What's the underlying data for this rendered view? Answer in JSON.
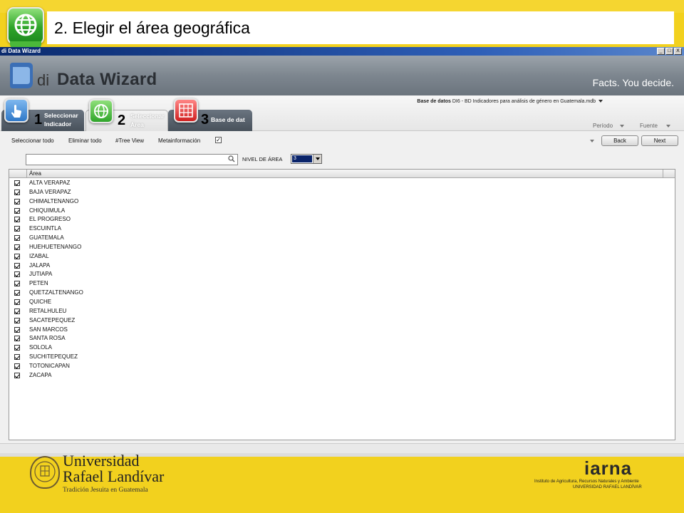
{
  "slide": {
    "title": "2. Elegir el área geográfica"
  },
  "window": {
    "title": "di Data Wizard",
    "buttons": [
      "_",
      "□",
      "X"
    ]
  },
  "banner": {
    "logo_di": "di",
    "logo_name": "Data Wizard",
    "slogan": "Facts. You decide."
  },
  "steps": [
    {
      "number": "1",
      "label_line1": "Seleccionar",
      "label_line2": "Indicador",
      "icon": "hand-pointer-icon"
    },
    {
      "number": "2",
      "label_line1": "Seleccionar",
      "label_line2": "Área",
      "icon": "globe-icon"
    },
    {
      "number": "3",
      "label_line1": "Base de dat",
      "label_line2": "",
      "icon": "table-grid-icon"
    }
  ],
  "database": {
    "label": "Base de datos",
    "value": "DI6 - BD Indicadores para análisis de género en Guatemala.mdb"
  },
  "filters": {
    "periodo": "Período",
    "fuente": "Fuente"
  },
  "toolbar": {
    "select_all": "Seleccionar todo",
    "clear_all": "Eliminar todo",
    "tree_view": "#Tree View",
    "metainfo": "Metainformación",
    "back": "Back",
    "next": "Next"
  },
  "search": {
    "value": "",
    "nivel_label": "NIVEL DE ÁREA",
    "nivel_value": "3"
  },
  "list": {
    "header": "Área",
    "items": [
      "ALTA VERAPAZ",
      "BAJA VERAPAZ",
      "CHIMALTENANGO",
      "CHIQUIMULA",
      "EL PROGRESO",
      "ESCUINTLA",
      "GUATEMALA",
      "HUEHUETENANGO",
      "IZABAL",
      "JALAPA",
      "JUTIAPA",
      "PETEN",
      "QUETZALTENANGO",
      "QUICHE",
      "RETALHULEU",
      "SACATEPEQUEZ",
      "SAN MARCOS",
      "SANTA ROSA",
      "SOLOLA",
      "SUCHITEPEQUEZ",
      "TOTONICAPAN",
      "ZACAPA"
    ]
  },
  "footer": {
    "university_line1": "Universidad",
    "university_line2": "Rafael Landívar",
    "university_tagline": "Tradición Jesuita en Guatemala",
    "iarna": "iarna",
    "iarna_sub1": "Instituto de Agricultura, Recursos Naturales y Ambiente",
    "iarna_sub2": "UNIVERSIDAD RAFAEL LANDÍVAR"
  }
}
